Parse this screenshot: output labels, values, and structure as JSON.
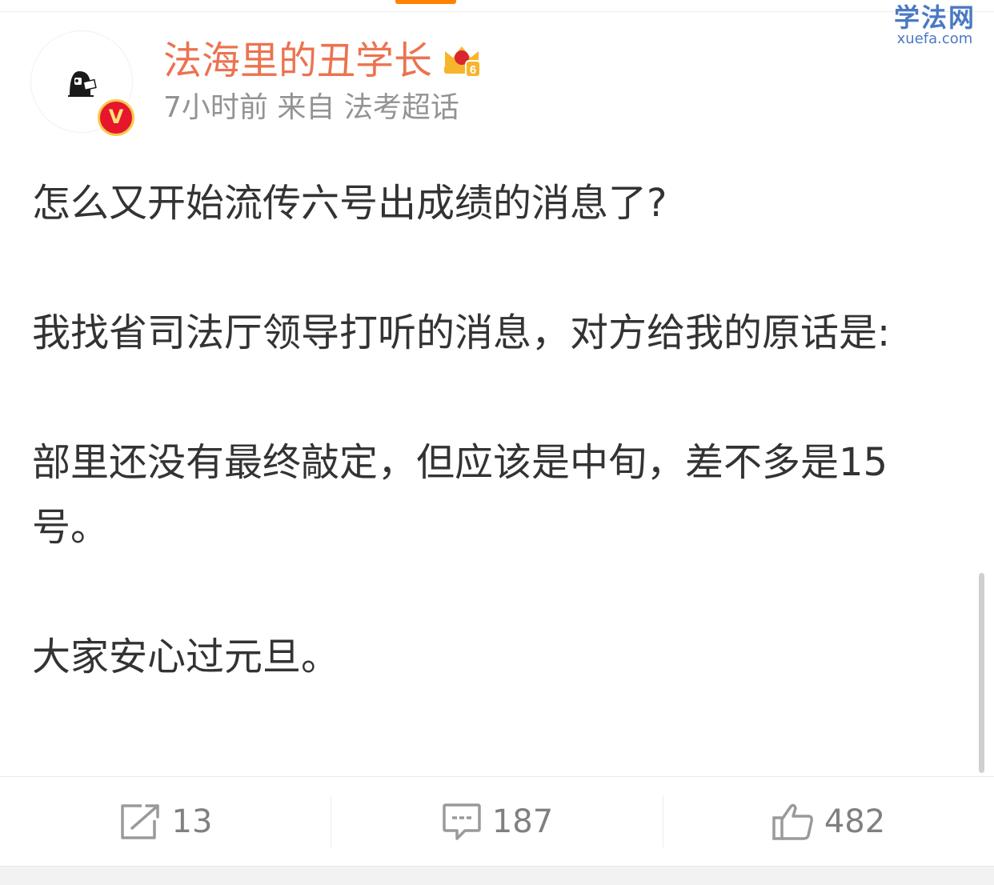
{
  "watermark": {
    "cn": "学法网",
    "en": "xuefa.com"
  },
  "user": {
    "name": "法海里的丑学长",
    "level": "6"
  },
  "meta": {
    "time": "7小时前",
    "from_label": "来自",
    "source": "法考超话"
  },
  "post": {
    "line1": "怎么又开始流传六号出成绩的消息了?",
    "line2": "我找省司法厅领导打听的消息，对方给我的原话是:",
    "line3": "部里还没有最终敲定，但应该是中旬，差不多是15号。",
    "line4": "大家安心过元旦。"
  },
  "actions": {
    "repost_count": "13",
    "comment_count": "187",
    "like_count": "482"
  },
  "colors": {
    "accent": "#ff8200",
    "username": "#eb7350",
    "meta": "#939393",
    "verified": "#e6162d"
  }
}
